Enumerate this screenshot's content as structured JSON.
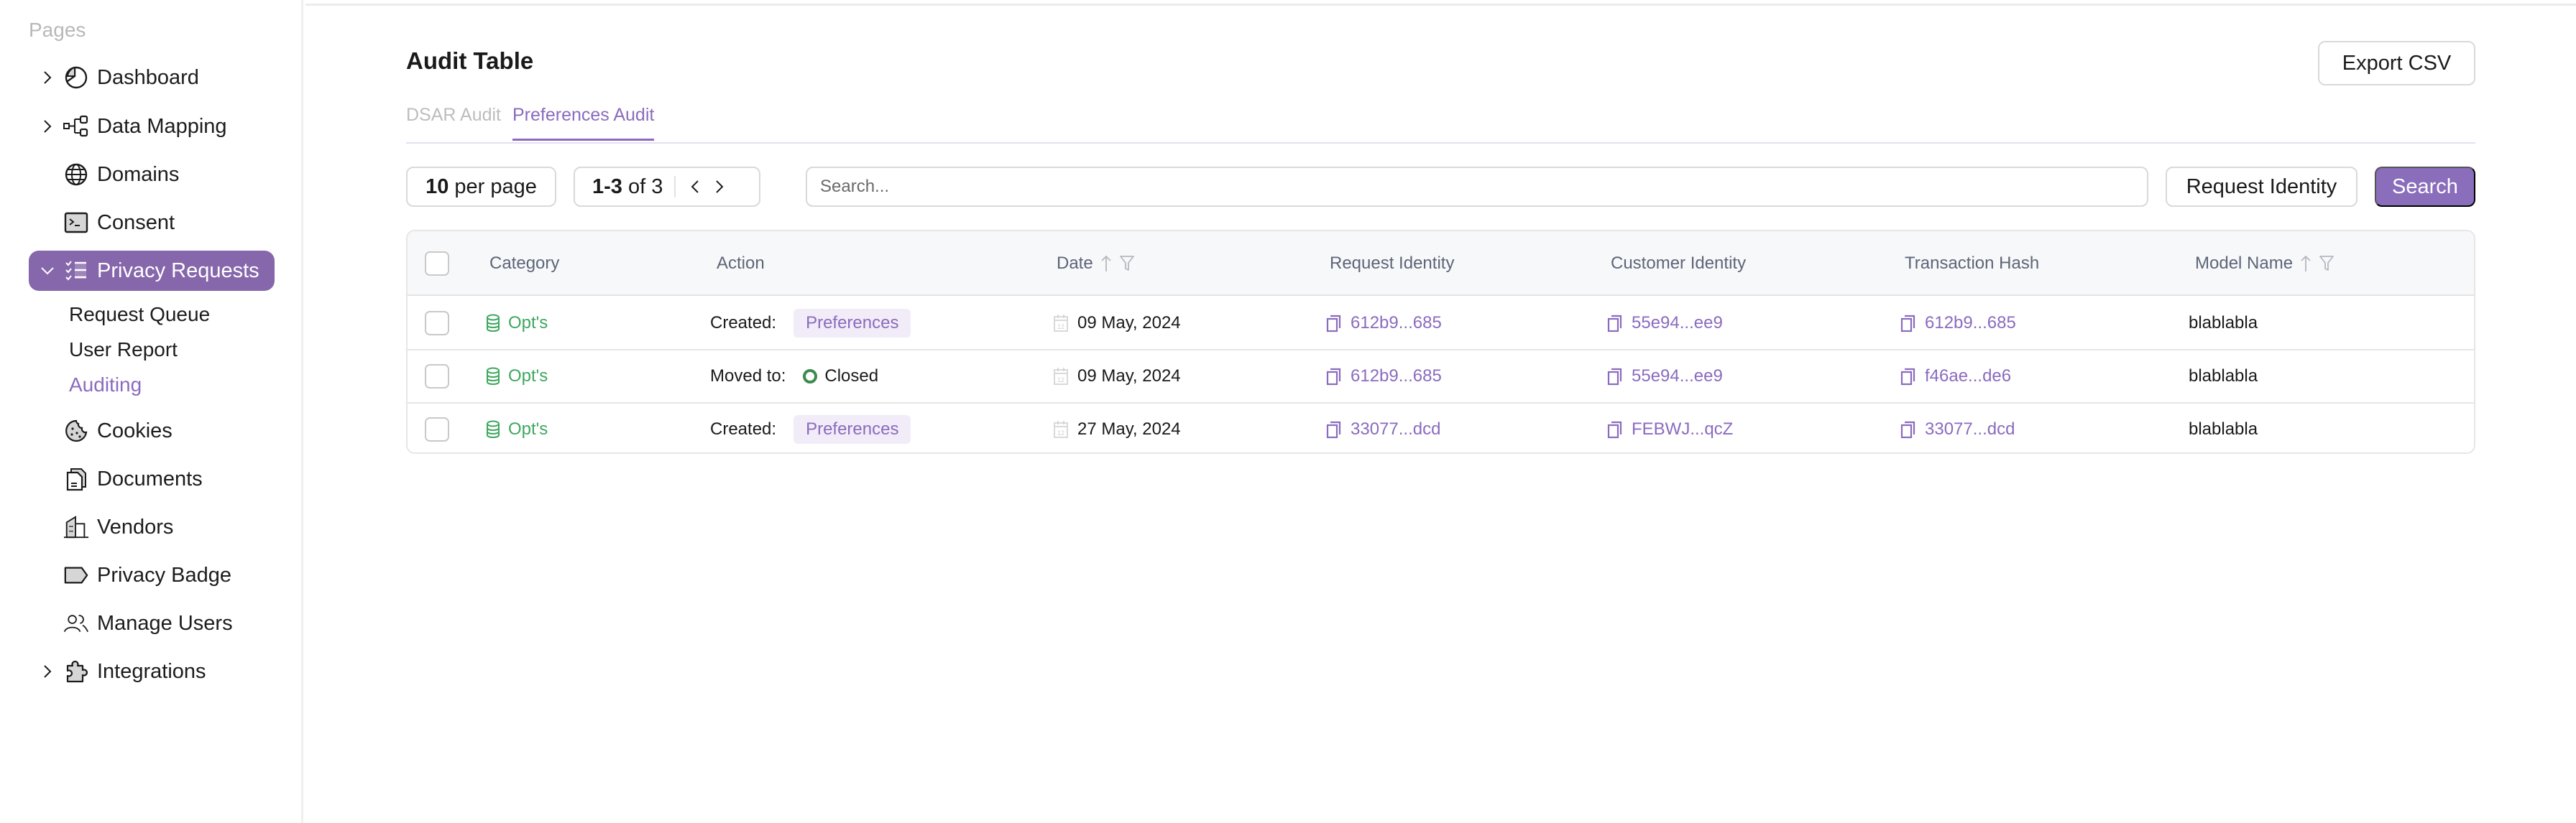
{
  "sidebar": {
    "section_label": "Pages",
    "items": [
      {
        "label": "Dashboard",
        "icon": "pie-chart-icon",
        "has_chevron": true
      },
      {
        "label": "Data Mapping",
        "icon": "hierarchy-icon",
        "has_chevron": true
      },
      {
        "label": "Domains",
        "icon": "globe-icon",
        "has_chevron": false
      },
      {
        "label": "Consent",
        "icon": "terminal-icon",
        "has_chevron": false
      },
      {
        "label": "Privacy Requests",
        "icon": "checklist-icon",
        "has_chevron": true,
        "expanded": true,
        "active": true
      },
      {
        "label": "Cookies",
        "icon": "cookie-icon",
        "has_chevron": false
      },
      {
        "label": "Documents",
        "icon": "documents-icon",
        "has_chevron": false
      },
      {
        "label": "Vendors",
        "icon": "building-icon",
        "has_chevron": false
      },
      {
        "label": "Privacy Badge",
        "icon": "tag-icon",
        "has_chevron": false
      },
      {
        "label": "Manage Users",
        "icon": "users-icon",
        "has_chevron": false
      },
      {
        "label": "Integrations",
        "icon": "puzzle-icon",
        "has_chevron": true
      }
    ],
    "sub_items": [
      {
        "label": "Request Queue",
        "active": false
      },
      {
        "label": "User Report",
        "active": false
      },
      {
        "label": "Auditing",
        "active": true
      }
    ]
  },
  "header": {
    "title": "Audit Table",
    "export_label": "Export CSV"
  },
  "tabs": [
    {
      "label": "DSAR Audit",
      "active": false
    },
    {
      "label": "Preferences Audit",
      "active": true
    }
  ],
  "toolbar": {
    "per_page_value": "10",
    "per_page_suffix": "per page",
    "range": "1-3",
    "range_of": "of 3",
    "search_placeholder": "Search...",
    "request_identity_label": "Request Identity",
    "search_label": "Search"
  },
  "table": {
    "columns": [
      "Category",
      "Action",
      "Date",
      "Request Identity",
      "Customer Identity",
      "Transaction Hash",
      "Model Name"
    ],
    "rows": [
      {
        "category": "Opt's",
        "action_label": "Created:",
        "action_value": "Preferences",
        "action_type": "badge",
        "date": "09 May, 2024",
        "request_identity": "612b9...685",
        "customer_identity": "55e94...ee9",
        "transaction_hash": "612b9...685",
        "model_name": "blablabla"
      },
      {
        "category": "Opt's",
        "action_label": "Moved to:",
        "action_value": "Closed",
        "action_type": "status",
        "date": "09 May, 2024",
        "request_identity": "612b9...685",
        "customer_identity": "55e94...ee9",
        "transaction_hash": "f46ae...de6",
        "model_name": "blablabla"
      },
      {
        "category": "Opt's",
        "action_label": "Created:",
        "action_value": "Preferences",
        "action_type": "badge",
        "date": "27 May, 2024",
        "request_identity": "33077...dcd",
        "customer_identity": "FEBWJ...qcZ",
        "transaction_hash": "33077...dcd",
        "model_name": "blablabla"
      }
    ]
  },
  "colors": {
    "accent": "#8a6bbf",
    "active_nav_bg": "#8667ab",
    "category_green": "#3fa760",
    "closed_status": "#3d8b4f",
    "badge_bg": "#f1ecf7"
  }
}
